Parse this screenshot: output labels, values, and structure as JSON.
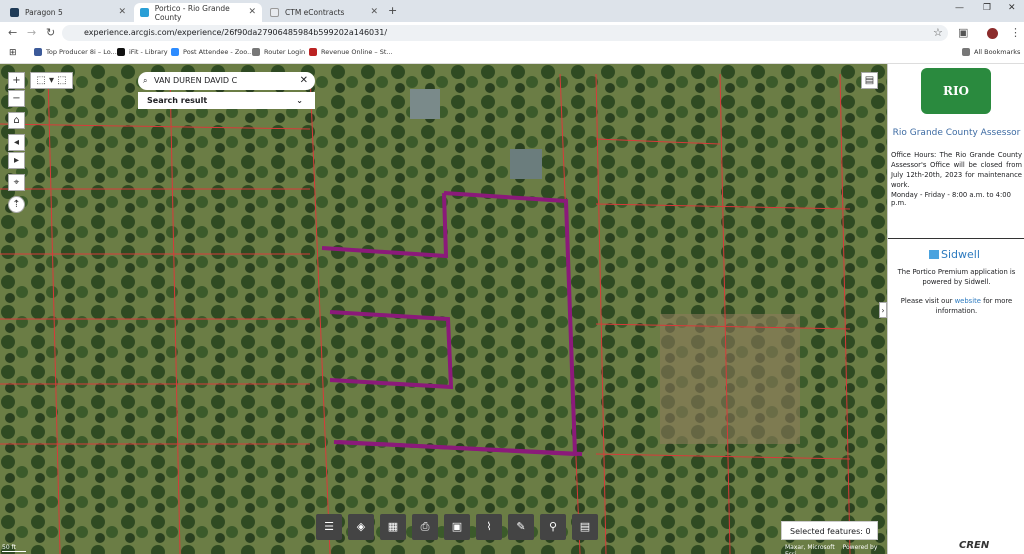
{
  "tabs": [
    {
      "label": "Paragon 5",
      "color": "#1f3b57"
    },
    {
      "label": "Portico - Rio Grande County",
      "color": "#2a9fd6"
    },
    {
      "label": "CTM eContracts",
      "color": "#e7eaee"
    }
  ],
  "address": {
    "url": "experience.arcgis.com/experience/26f90da27906485984b599202a146031/"
  },
  "bookmarks": [
    {
      "label": "Top Producer 8i – Lo...",
      "color": "#3c5a99"
    },
    {
      "label": "iFit - Library",
      "color": "#111"
    },
    {
      "label": "Post Attendee - Zoo...",
      "color": "#2d8cff"
    },
    {
      "label": "Router Login",
      "color": "#777"
    },
    {
      "label": "Revenue Online – St...",
      "color": "#b22"
    }
  ],
  "all_bookmarks": "All Bookmarks",
  "map": {
    "search_value": "VAN DUREN DAVID C",
    "results_label": "Search result",
    "selected_features": "Selected features: 0",
    "attribution": "Maxar, Microsoft",
    "attribution2": "Powered by Esri",
    "scale": "50 ft"
  },
  "panel": {
    "title": "Rio Grande County Assessor",
    "notice": "Office Hours: The Rio Grande County Assessor's Office will be closed from July 12th-20th, 2023 for maintenance work.",
    "hours": "Monday - Friday - 8:00 a.m. to 4:00 p.m.",
    "logo_text": "RIO GRANDE",
    "sidwell": "Sidwell",
    "powered": "The Portico Premium application is powered by Sidwell.",
    "visit_pre": "Please visit our ",
    "visit_link": "website",
    "visit_post": " for more information."
  },
  "footer_logo": "CREN"
}
